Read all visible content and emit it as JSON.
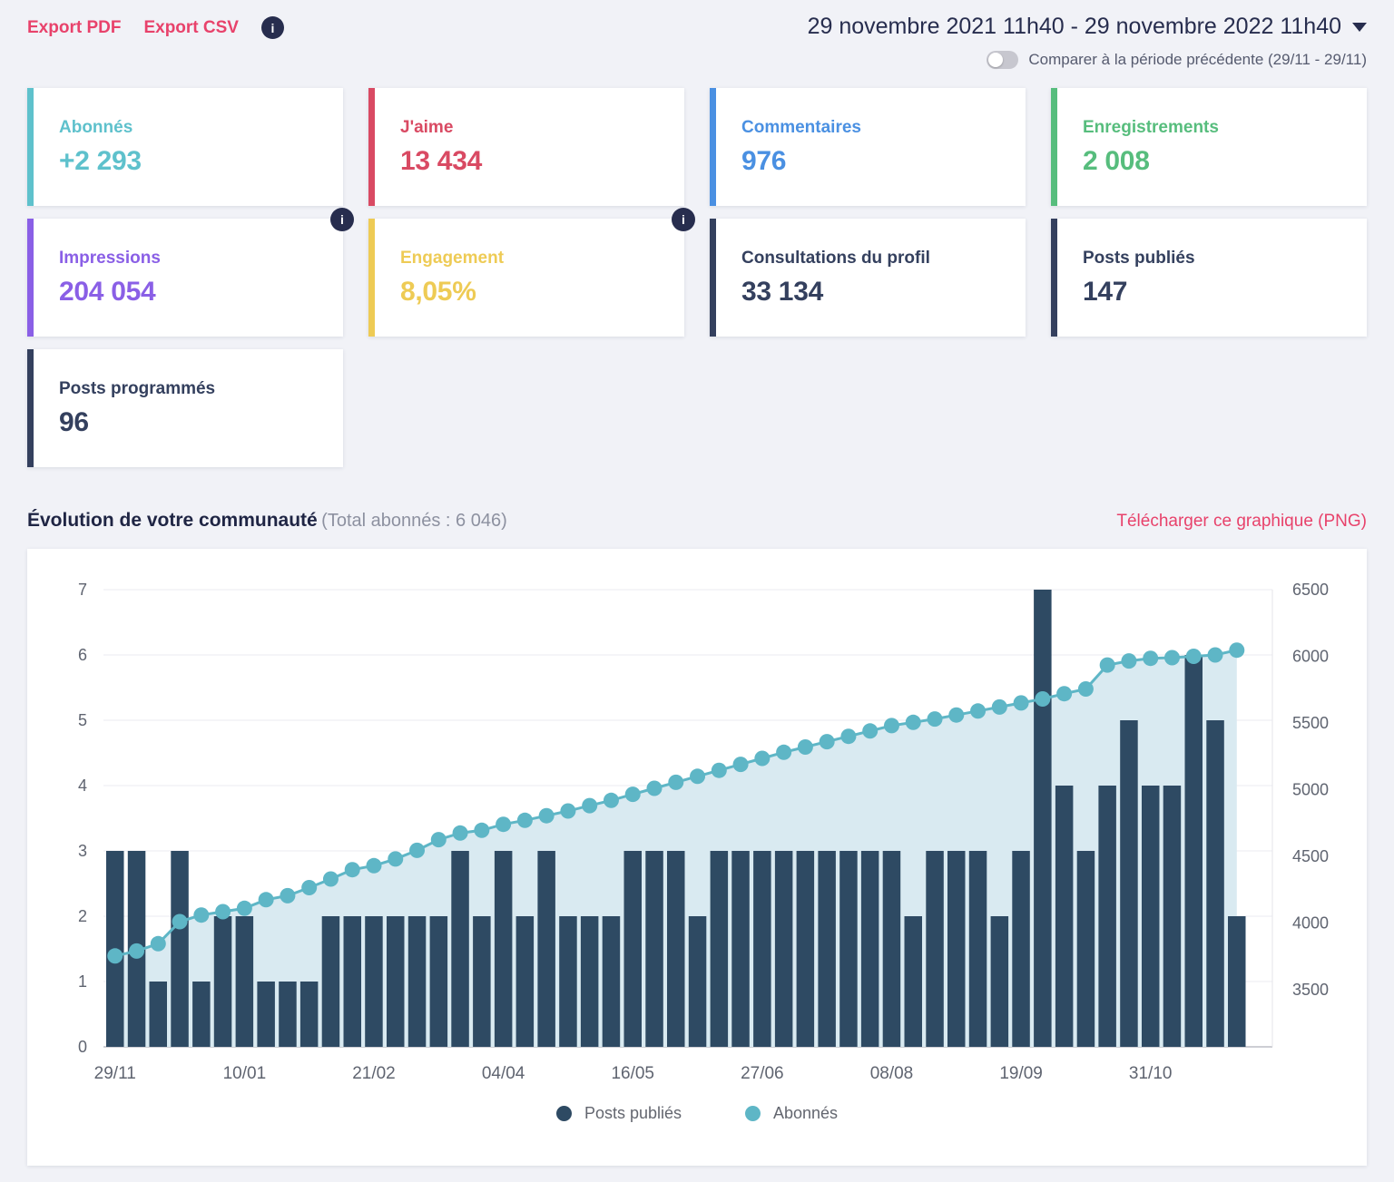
{
  "header": {
    "export_pdf": "Export PDF",
    "export_csv": "Export CSV",
    "info_glyph": "i",
    "date_range": "29 novembre 2021 11h40 - 29 novembre 2022 11h40",
    "compare_label": "Comparer à la période précédente (29/11 - 29/11)",
    "toggle_state": "off"
  },
  "stats": [
    {
      "label": "Abonnés",
      "value": "+2 293",
      "color": "#5ec1cc",
      "info": false
    },
    {
      "label": "J'aime",
      "value": "13 434",
      "color": "#d94a63",
      "info": false
    },
    {
      "label": "Commentaires",
      "value": "976",
      "color": "#4a90e2",
      "info": false
    },
    {
      "label": "Enregistrements",
      "value": "2 008",
      "color": "#57bd7d",
      "info": false
    },
    {
      "label": "Impressions",
      "value": "204 054",
      "color": "#8a5fe6",
      "info": true
    },
    {
      "label": "Engagement",
      "value": "8,05%",
      "color": "#eecb55",
      "info": true
    },
    {
      "label": "Consultations du profil",
      "value": "33 134",
      "color": "#34405e",
      "info": false
    },
    {
      "label": "Posts publiés",
      "value": "147",
      "color": "#34405e",
      "info": false
    },
    {
      "label": "Posts programmés",
      "value": "96",
      "color": "#34405e",
      "info": false
    }
  ],
  "section": {
    "title": "Évolution de votre communauté",
    "subtitle": "(Total abonnés : 6 046)",
    "download_label": "Télécharger ce graphique (PNG)"
  },
  "chart_data": {
    "type": "bar+line",
    "title": "Évolution de votre communauté",
    "grid": true,
    "legend_position": "bottom",
    "left_axis": {
      "label": "Posts publiés",
      "min": 0,
      "max": 7,
      "ticks": [
        0,
        1,
        2,
        3,
        4,
        5,
        6,
        7
      ]
    },
    "right_axis": {
      "label": "Abonnés",
      "min": 3500,
      "max": 6500,
      "ticks": [
        3500,
        4000,
        4500,
        5000,
        5500,
        6000,
        6500
      ]
    },
    "x_tick_labels": [
      "29/11",
      "10/01",
      "21/02",
      "04/04",
      "16/05",
      "27/06",
      "08/08",
      "19/09",
      "31/10"
    ],
    "x_tick_indices": [
      0,
      6,
      12,
      18,
      24,
      30,
      36,
      42,
      48
    ],
    "series": [
      {
        "name": "Posts publiés",
        "type": "bar",
        "axis": "left",
        "color": "#2e4a63",
        "values": [
          3,
          3,
          1,
          3,
          1,
          2,
          2,
          1,
          1,
          1,
          2,
          2,
          2,
          2,
          2,
          2,
          3,
          2,
          3,
          2,
          3,
          2,
          2,
          2,
          3,
          3,
          3,
          2,
          3,
          3,
          3,
          3,
          3,
          3,
          3,
          3,
          3,
          2,
          3,
          3,
          3,
          2,
          3,
          7,
          4,
          3,
          4,
          5,
          4,
          4,
          6,
          5,
          2
        ]
      },
      {
        "name": "Abonnés",
        "type": "line",
        "axis": "right",
        "color": "#5eb6c6",
        "area_color": "#d9eaf1",
        "values": [
          3753,
          3790,
          3845,
          4010,
          4060,
          4085,
          4110,
          4175,
          4205,
          4265,
          4330,
          4400,
          4430,
          4480,
          4545,
          4625,
          4675,
          4695,
          4740,
          4770,
          4805,
          4840,
          4880,
          4920,
          4965,
          5010,
          5055,
          5100,
          5145,
          5190,
          5235,
          5280,
          5320,
          5360,
          5400,
          5440,
          5480,
          5505,
          5530,
          5560,
          5590,
          5620,
          5650,
          5680,
          5720,
          5755,
          5935,
          5965,
          5985,
          5990,
          6000,
          6010,
          6046
        ]
      }
    ]
  }
}
